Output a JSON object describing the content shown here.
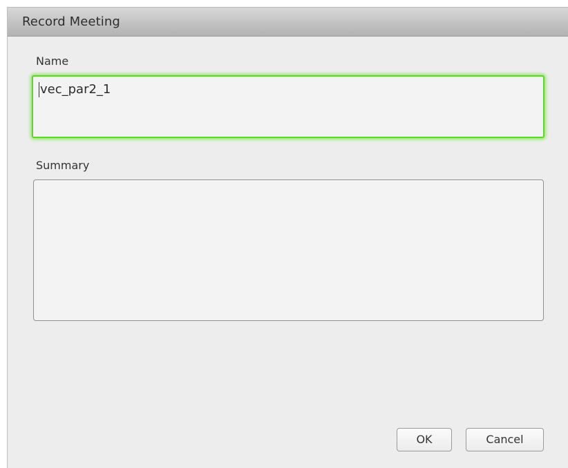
{
  "dialog": {
    "title": "Record Meeting",
    "name_label": "Name",
    "name_value": "vec_par2_1",
    "summary_label": "Summary",
    "summary_value": "",
    "ok_label": "OK",
    "cancel_label": "Cancel",
    "focus_color": "#5fd32f"
  }
}
